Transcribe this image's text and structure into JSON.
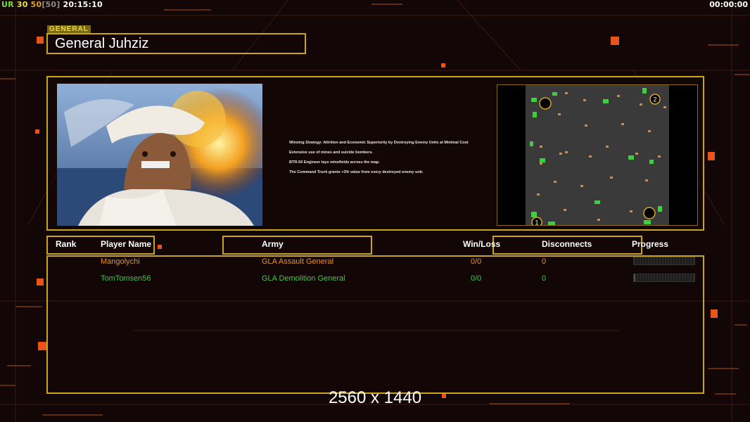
{
  "hud": {
    "ur": "UR",
    "fps_a": "30",
    "fps_b": "50",
    "fps_c": "[50]",
    "clock": "20:15:10",
    "timer": "00:00:00"
  },
  "general": {
    "tag": "GENERAL",
    "name": "General Juhziz"
  },
  "description": [
    "Winning Strategy: Attrition and Economic Superiority by Destroying Enemy Units at Minimal Cost",
    "Extensive use of mines and suicide bombers.",
    "BTR-50 Engineer lays minefields across the map.",
    "The Command Truck grants +3% value from every destroyed enemy unit."
  ],
  "minimap": {
    "start_1": "1",
    "start_2": "2"
  },
  "columns": {
    "rank": "Rank",
    "player_name": "Player Name",
    "army": "Army",
    "win_loss": "Win/Loss",
    "disconnects": "Disconnects",
    "progress": "Progress"
  },
  "players": [
    {
      "name": "Mangolychi",
      "army": "GLA Assault General",
      "win_loss": "0/0",
      "disconnects": "0",
      "progress": 0.0,
      "color": "#e8912c"
    },
    {
      "name": "TomTomsen56",
      "army": "GLA Demolition General",
      "win_loss": "0/0",
      "disconnects": "0",
      "progress": 0.02,
      "color": "#3fc93f"
    }
  ],
  "resolution": "2560 x 1440",
  "colors": {
    "frame": "#c9a51b",
    "background": "#120706",
    "player1": "#e8912c",
    "player2": "#3fc93f"
  }
}
